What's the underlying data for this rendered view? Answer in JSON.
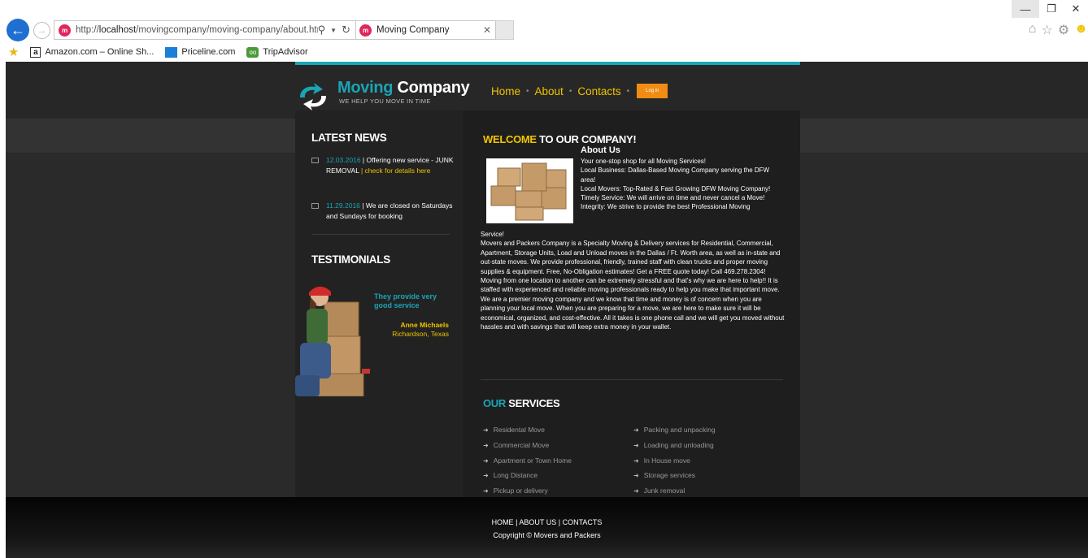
{
  "browser": {
    "url_prefix": "http://",
    "url_host": "localhost",
    "url_path": "/movingcompany/moving-company/about.htm",
    "tab_title": "Moving Company",
    "favorites": [
      "Amazon.com – Online Sh...",
      "Priceline.com",
      "TripAdvisor"
    ]
  },
  "site": {
    "logo_word1": "Moving",
    "logo_word2": "Company",
    "tagline": "WE HELP YOU MOVE IN TIME",
    "menu": {
      "home": "Home",
      "about": "About",
      "contacts": "Contacts",
      "login": "Log in"
    },
    "sidebar": {
      "news_title": "LATEST NEWS",
      "news": [
        {
          "date": "12.03.2016",
          "text": " | Offering new service - JUNK REMOVAL ",
          "link": "| check for details here"
        },
        {
          "date": "11.29.2016",
          "text": " | We are closed on Saturdays and Sundays for booking",
          "link": ""
        }
      ],
      "testimonials_title": "TESTIMONIALS",
      "quote": "They provide very good service",
      "author": "Anne Michaels",
      "location": "Richardson, Texas"
    },
    "main": {
      "welcome_accent": "WELCOME",
      "welcome_rest": " TO OUR COMPANY!",
      "about_title": "About Us",
      "about_lines": [
        "Your one-stop shop for all Moving Services!",
        "Local Business: Dallas-Based Moving Company serving the DFW area!",
        "Local Movers: Top-Rated & Fast Growing DFW Moving Company!",
        "Timely Service: We will arrive on time and never cancel a Move!",
        "Integrity: We strive to provide the best Professional Moving"
      ],
      "service_tail": "Service!",
      "about_paragraph": "Movers and Packers Company is a Specialty Moving & Delivery services for Residential, Commercial, Apartment, Storage Units, Load and Unload moves in the Dallas / Ft. Worth area, as well as in-state and out-state moves. We provide professional, friendly, trained staff with clean trucks and proper moving supplies & equipment. Free, No-Obligation estimates! Get a FREE quote today! Call 469.278.2304! Moving from one location to another can be extremely stressful and that's why we are here to help!! It is staffed with experienced and reliable moving professionals ready to help you make that important move. We are a premier moving company and we know that time and money is of concern when you are planning your local move. When you are preparing for a move, we are here to make sure it will be economical, organized, and cost-effective. All it takes is one phone call and we will get you moved without hassles and with savings that will keep extra money in your wallet.",
      "services_accent": "OUR",
      "services_rest": " SERVICES",
      "services_left": [
        "Residental Move",
        "Commercial Move",
        "Apartment or Town Home",
        "Long Distance",
        "Pickup or delivery"
      ],
      "services_right": [
        "Packing and unpacking",
        "Loading and unloading",
        "In House move",
        "Storage services",
        "Junk removal"
      ]
    },
    "footer": {
      "links": "HOME | ABOUT US | CONTACTS",
      "copyright": "Copyright © Movers and Packers"
    }
  }
}
